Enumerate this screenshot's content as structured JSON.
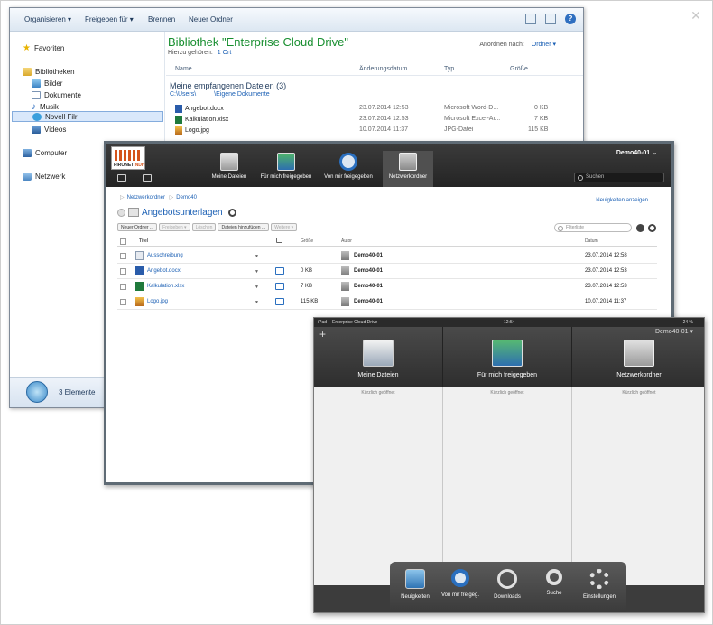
{
  "explorer": {
    "toolbar": [
      "Organisieren ▾",
      "Freigeben für ▾",
      "Brennen",
      "Neuer Ordner"
    ],
    "nav": {
      "favorites": "Favoriten",
      "libraries": "Bibliotheken",
      "pictures": "Bilder",
      "documents": "Dokumente",
      "music": "Musik",
      "filr": "Novell Filr",
      "videos": "Videos",
      "computer": "Computer",
      "network": "Netzwerk"
    },
    "library_title": "Bibliothek \"Enterprise Cloud Drive\"",
    "library_sub": "Hierzu gehören:",
    "library_sub_link": "1 Ort",
    "arrange_label": "Anordnen nach:",
    "arrange_value": "Ordner ▾",
    "columns": [
      "Name",
      "Änderungsdatum",
      "Typ",
      "Größe"
    ],
    "group_title": "Meine empfangenen Dateien (3)",
    "group_path": [
      "C:\\Users\\",
      "\\Eigene Dokumente"
    ],
    "files": [
      {
        "name": "Angebot.docx",
        "date": "23.07.2014 12:53",
        "type": "Microsoft Word-D...",
        "size": "0 KB"
      },
      {
        "name": "Kalkulation.xlsx",
        "date": "23.07.2014 12:53",
        "type": "Microsoft Excel-Ar...",
        "size": "7 KB"
      },
      {
        "name": "Logo.jpg",
        "date": "10.07.2014 11:37",
        "type": "JPG-Datei",
        "size": "115 KB"
      }
    ],
    "status": "3 Elemente"
  },
  "web": {
    "logo_text": "PIRONET",
    "logo_text2": "NDH",
    "tabs": [
      "Meine Dateien",
      "Für mich freigegeben",
      "Von mir freigegeben",
      "Netzwerkordner"
    ],
    "user": "Demo40-01 ⌄",
    "search_placeholder": "Suchen",
    "breadcrumb": [
      "Netzwerkordner",
      "Demo40"
    ],
    "news_link": "Neuigkeiten anzeigen",
    "folder_title": "Angebotsunterlagen",
    "actions": [
      "Neuer Ordner ...",
      "Freigeben ▾",
      "Löschen",
      "Dateien hinzufügen ...",
      "Weitere ▾"
    ],
    "filter_placeholder": "Filterliste",
    "columns": [
      "Titel",
      "Größe",
      "Autor",
      "Datum"
    ],
    "rows": [
      {
        "title": "Ausschreibung",
        "size": "",
        "author": "Demo40-01",
        "date": "23.07.2014 12:58",
        "icon": "folder-icon"
      },
      {
        "title": "Angebot.docx",
        "size": "0 KB",
        "author": "Demo40-01",
        "date": "23.07.2014 12:53",
        "icon": "word-file-icon"
      },
      {
        "title": "Kalkulation.xlsx",
        "size": "7 KB",
        "author": "Demo40-01",
        "date": "23.07.2014 12:53",
        "icon": "excel-file-icon"
      },
      {
        "title": "Logo.jpg",
        "size": "115 KB",
        "author": "Demo40-01",
        "date": "10.07.2014 11:37",
        "icon": "image-file-icon"
      }
    ]
  },
  "ipad": {
    "status_left": "iPad",
    "status_app": "Enterprise Cloud Drive",
    "status_time": "12:54",
    "status_battery": "24 %",
    "user": "Demo40-01 ▾",
    "tiles": [
      "Meine Dateien",
      "Für mich freigegeben",
      "Netzwerkordner"
    ],
    "recent": "Kürzlich geöffnet",
    "dock": [
      "Neuigkeiten",
      "Von mir freigeg.",
      "Downloads",
      "Suche",
      "Einstellungen"
    ]
  }
}
